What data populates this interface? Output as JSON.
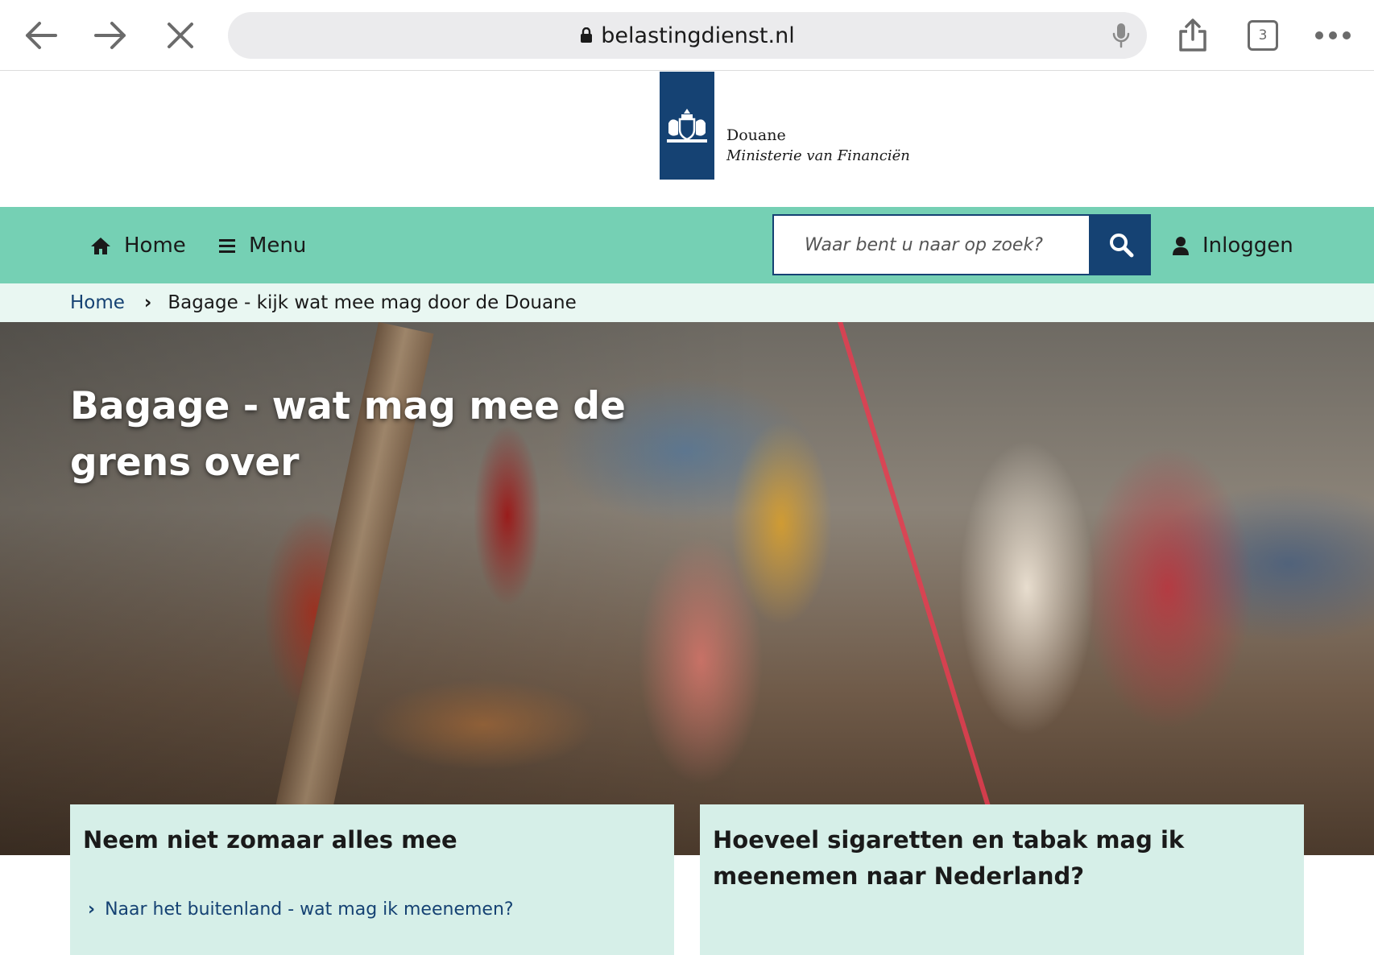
{
  "browser": {
    "url": "belastingdienst.nl",
    "tab_count": "3"
  },
  "header": {
    "org_name": "Douane",
    "ministry": "Ministerie van Financiën"
  },
  "nav": {
    "home_label": "Home",
    "menu_label": "Menu",
    "search_placeholder": "Waar bent u naar op zoek?",
    "login_label": "Inloggen"
  },
  "breadcrumb": {
    "home": "Home",
    "current": "Bagage - kijk wat mee mag door de Douane"
  },
  "hero": {
    "title": "Bagage - wat mag mee de grens over"
  },
  "cards": [
    {
      "title": "Neem niet zomaar alles mee",
      "links": [
        "Naar het buitenland - wat mag ik meenemen?"
      ]
    },
    {
      "title": "Hoeveel sigaretten en tabak mag ik meenemen naar Nederland?",
      "links": []
    }
  ],
  "colors": {
    "nav_bg": "#75d0b4",
    "brand_blue": "#154273",
    "breadcrumb_bg": "#e9f7f2",
    "card_bg": "#d6efe8"
  }
}
